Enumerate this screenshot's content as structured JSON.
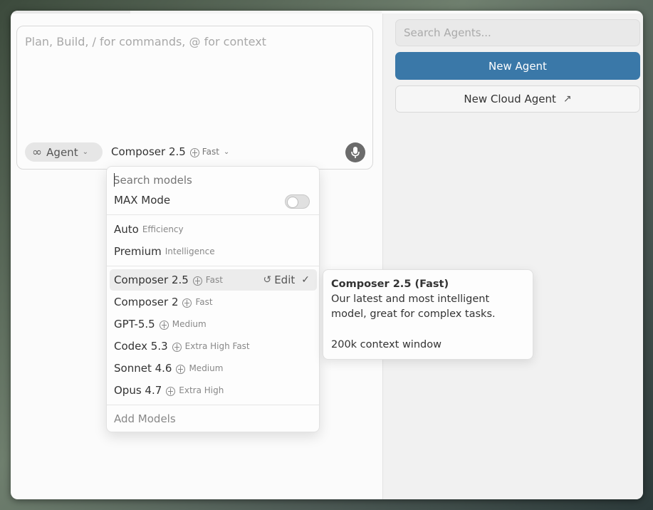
{
  "composer": {
    "placeholder": "Plan, Build, / for commands, @ for context",
    "mode_label": "Agent",
    "mode_icon": "infinity-icon",
    "model_name": "Composer 2.5",
    "model_speed": "Fast",
    "mic_icon": "microphone-icon"
  },
  "right_panel": {
    "search_placeholder": "Search Agents...",
    "new_agent_label": "New Agent",
    "new_cloud_agent_label": "New Cloud Agent",
    "accent_color": "#3a78a8"
  },
  "model_menu": {
    "search_placeholder": "Search models",
    "max_mode_label": "MAX Mode",
    "max_mode_enabled": false,
    "presets": [
      {
        "name": "Auto",
        "sub": "Efficiency"
      },
      {
        "name": "Premium",
        "sub": "Intelligence"
      }
    ],
    "models": [
      {
        "name": "Composer 2.5",
        "sub": "Fast",
        "selected": true
      },
      {
        "name": "Composer 2",
        "sub": "Fast"
      },
      {
        "name": "GPT-5.5",
        "sub": "Medium"
      },
      {
        "name": "Codex 5.3",
        "sub": "Extra High Fast"
      },
      {
        "name": "Sonnet 4.6",
        "sub": "Medium"
      },
      {
        "name": "Opus 4.7",
        "sub": "Extra High"
      }
    ],
    "edit_label": "Edit",
    "add_models_label": "Add Models"
  },
  "tooltip": {
    "title": "Composer 2.5 (Fast)",
    "description": "Our latest and most intelligent model, great for complex tasks.",
    "context": "200k context window"
  }
}
